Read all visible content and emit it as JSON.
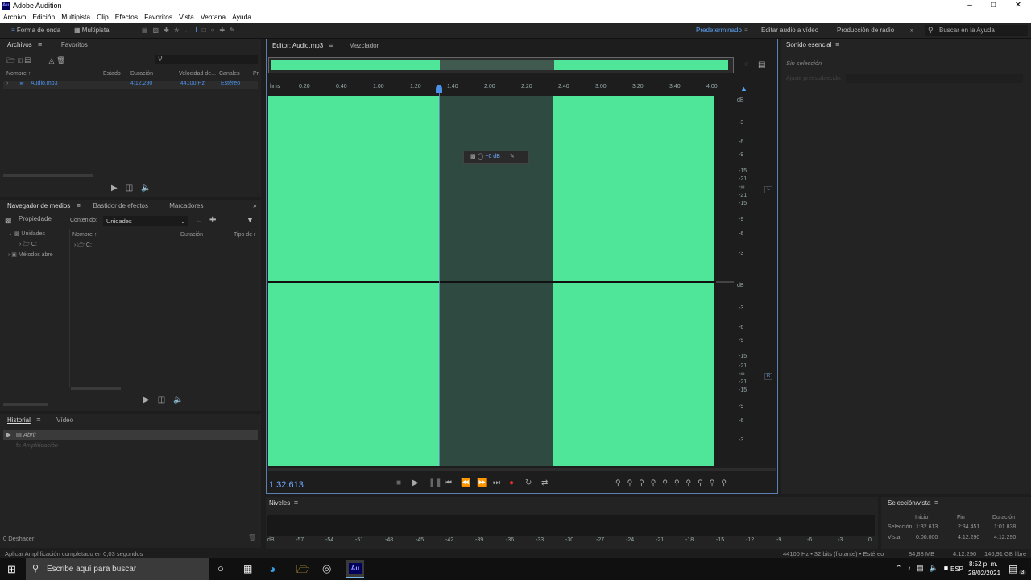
{
  "window": {
    "title": "Adobe Audition",
    "app_icon": "Au"
  },
  "menu": [
    "Archivo",
    "Edición",
    "Multipista",
    "Clip",
    "Efectos",
    "Favoritos",
    "Vista",
    "Ventana",
    "Ayuda"
  ],
  "toolbar": {
    "waveform": "Forma de onda",
    "multitrack": "Multipista",
    "workspaces": [
      "Predeterminado",
      "Editar audio a vídeo",
      "Producción de radio"
    ],
    "search_placeholder": "Buscar en la Ayuda"
  },
  "files_panel": {
    "tabs": [
      "Archivos",
      "Favoritos"
    ],
    "columns": [
      "Nombre ↑",
      "Estado",
      "Duración",
      "Velocidad de...",
      "Canales",
      "Pr"
    ],
    "file": {
      "name": "Audio.mp3",
      "duration": "4:12.290",
      "rate": "44100 Hz",
      "channels": "Estéreo"
    }
  },
  "media_panel": {
    "tabs": [
      "Navegador de medios",
      "Bastidor de efectos",
      "Marcadores",
      "Propiedade"
    ],
    "content_label": "Contenido:",
    "content_value": "Unidades",
    "tree": [
      "Unidades",
      "C:",
      "Métodos abre"
    ],
    "columns": [
      "Nombre ↑",
      "Duración",
      "Tipo de r"
    ],
    "row": "C:"
  },
  "history_panel": {
    "tabs": [
      "Historial",
      "Vídeo"
    ],
    "items": [
      "Abrir",
      "Amplificación"
    ],
    "undo": "0 Deshacer"
  },
  "editor": {
    "tabs": [
      "Editor: Audio.mp3",
      "Mezclador"
    ],
    "ruler": [
      "hms",
      "0:20",
      "0:40",
      "1:00",
      "1:20",
      "1:40",
      "2:00",
      "2:20",
      "2:40",
      "3:00",
      "3:20",
      "3:40",
      "4:00"
    ],
    "db_labels": [
      "dB",
      "-3",
      "-6",
      "-9",
      "-15",
      "-21",
      "-∞",
      "-21",
      "-15",
      "-9",
      "-6",
      "-3"
    ],
    "channels": [
      "L",
      "R"
    ],
    "hud_gain": "+0 dB",
    "timecode": "1:32.613"
  },
  "essential": {
    "title": "Sonido esencial",
    "no_selection": "Sin selección",
    "preset": "Ajuste preestablecido:"
  },
  "levels": {
    "title": "Niveles",
    "scale": [
      "dB",
      "-57",
      "-54",
      "-51",
      "-48",
      "-45",
      "-42",
      "-39",
      "-36",
      "-33",
      "-30",
      "-27",
      "-24",
      "-21",
      "-18",
      "-15",
      "-12",
      "-9",
      "-6",
      "-3",
      "0"
    ]
  },
  "selection_view": {
    "title": "Selección/vista",
    "headers": [
      "Inicio",
      "Fin",
      "Duración"
    ],
    "rows": [
      {
        "label": "Selección",
        "start": "1:32.613",
        "end": "2:34.451",
        "dur": "1:01.838"
      },
      {
        "label": "Vista",
        "start": "0:00.000",
        "end": "4:12.290",
        "dur": "4:12.290"
      }
    ]
  },
  "status": {
    "message": "Aplicar Amplificación completado en 0,03 segundos",
    "format": "44100 Hz • 32 bits (flotante) • Estéreo",
    "size": "84,88 MB",
    "duration": "4:12.290",
    "free": "146,91 GB libre"
  },
  "taskbar": {
    "search": "Escribe aquí para buscar",
    "lang": "ESP",
    "time": "8:52 p. m.",
    "date": "28/02/2021",
    "notif": "3"
  }
}
